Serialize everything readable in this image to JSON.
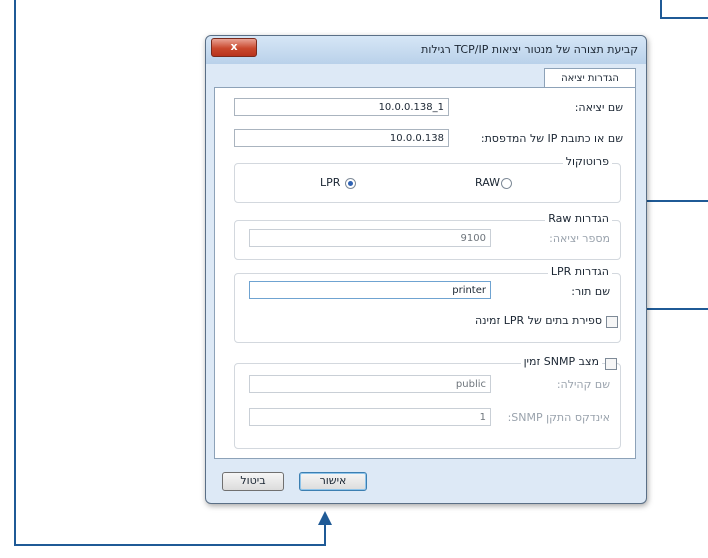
{
  "dialog": {
    "title": "קביעת תצורה של מנטור יציאות TCP/IP רגילות",
    "close_label": "x",
    "tab_label": "הגדרות יציאה",
    "port_name_label": "שם יציאה:",
    "port_name_value": "10.0.0.138_1",
    "printer_address_label": "שם או כתובת IP של המדפסת:",
    "printer_address_value": "10.0.0.138",
    "protocol": {
      "legend": "פרוטוקול",
      "raw_label": "RAW",
      "lpr_label": "LPR",
      "selected": "LPR"
    },
    "raw_settings": {
      "legend": "הגדרות Raw",
      "port_number_label": "מספר יציאה:",
      "port_number_value": "9100"
    },
    "lpr_settings": {
      "legend": "הגדרות LPR",
      "queue_name_label": "שם תור:",
      "queue_name_value": "printer",
      "byte_counting_label": "ספירת בתים של LPR זמינה"
    },
    "snmp": {
      "legend": "מצב SNMP זמין",
      "community_label": "שם קהילה:",
      "community_value": "public",
      "device_index_label": "אינדקס התקן SNMP:",
      "device_index_value": "1"
    },
    "ok_label": "אישור",
    "cancel_label": "ביטול"
  },
  "colors": {
    "annotation_line": "#1f5a96",
    "title_gradient_top": "#d6e6f6",
    "close_button": "#c9482d"
  }
}
